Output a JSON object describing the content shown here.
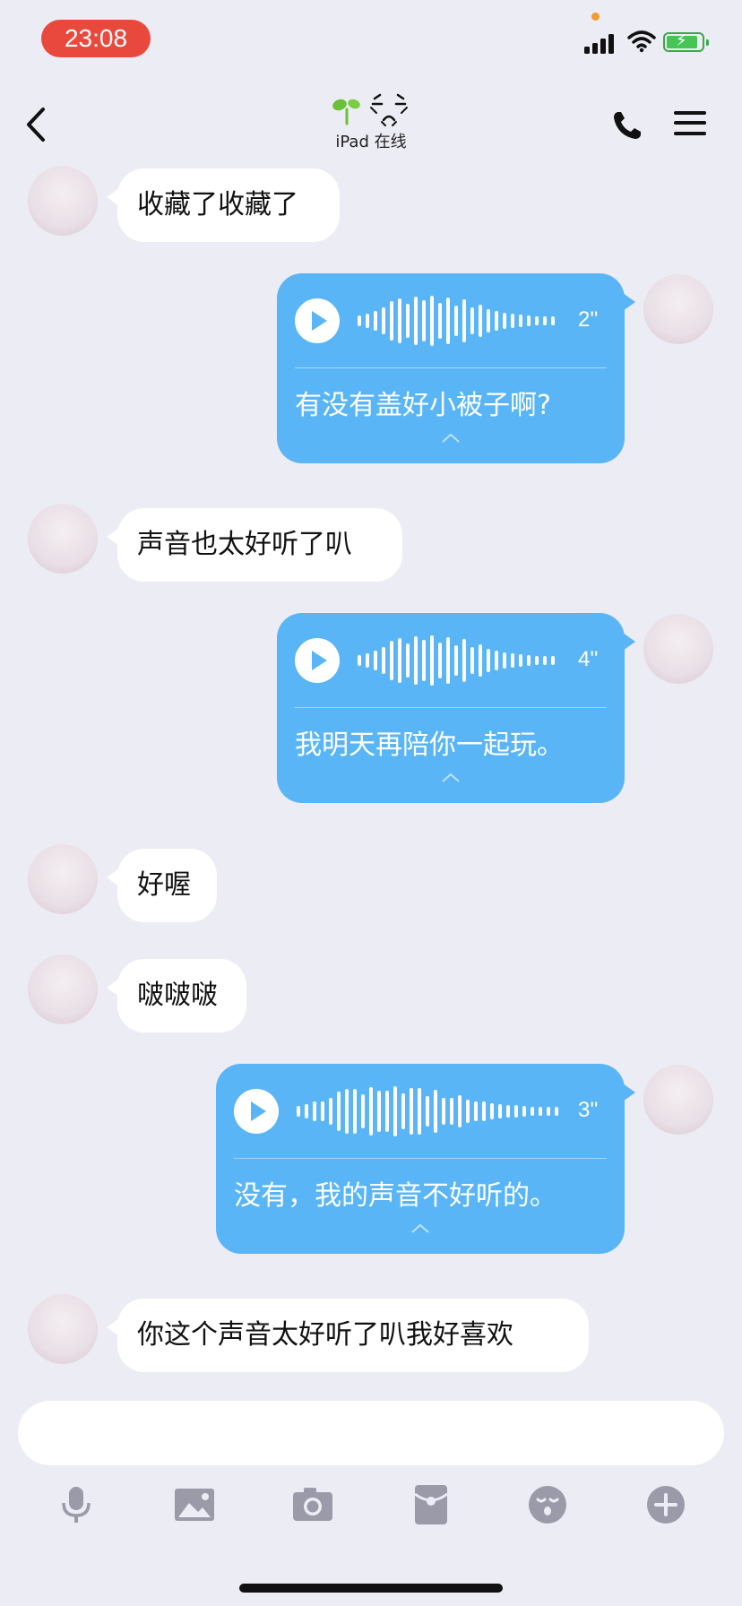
{
  "status_bar": {
    "time": "23:08",
    "colors": {
      "time_pill": "#e9493d",
      "battery": "#46c556",
      "privacy_dot": "#f59a2b"
    }
  },
  "header": {
    "subtitle": "iPad 在线",
    "icons": [
      "back-chevron-icon",
      "sprout-icon",
      "crying-face-icon",
      "phone-icon",
      "menu-icon"
    ]
  },
  "messages": [
    {
      "direction": "in",
      "text": "收藏了收藏了"
    },
    {
      "direction": "out",
      "type": "voice",
      "duration": "2''",
      "transcript": "有没有盖好小被子啊?"
    },
    {
      "direction": "in",
      "text": "声音也太好听了叭"
    },
    {
      "direction": "out",
      "type": "voice",
      "duration": "4''",
      "transcript": "我明天再陪你一起玩。"
    },
    {
      "direction": "in",
      "text": "好喔"
    },
    {
      "direction": "in",
      "text": "啵啵啵"
    },
    {
      "direction": "out",
      "type": "voice",
      "duration": "3''",
      "transcript": "没有，我的声音不好听的。"
    },
    {
      "direction": "in",
      "text": "你这个声音太好听了叭我好喜欢"
    }
  ],
  "composer": {
    "toolbar": [
      "microphone-icon",
      "image-icon",
      "camera-icon",
      "red-packet-icon",
      "emoji-icon",
      "plus-icon"
    ]
  },
  "colors": {
    "outgoing_bubble": "#59b5f6",
    "incoming_bubble": "#ffffff",
    "background": "#ececf4",
    "toolbar_icon": "#9b9aa8"
  }
}
